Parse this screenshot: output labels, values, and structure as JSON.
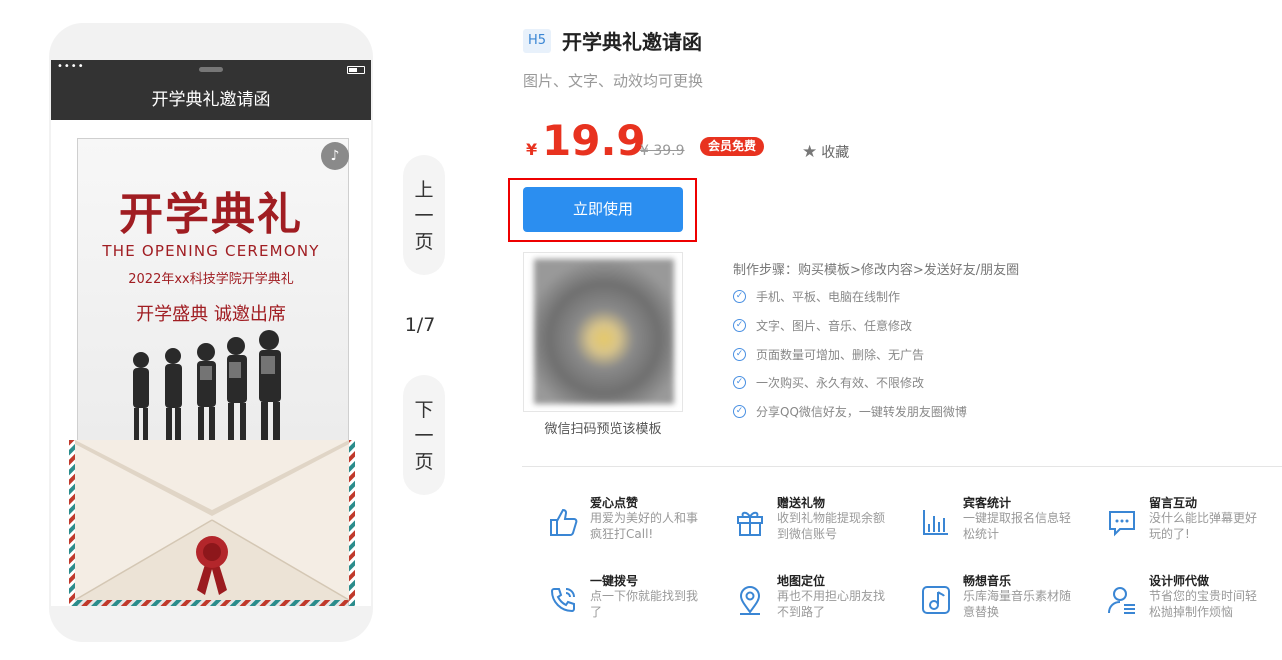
{
  "phone": {
    "status_dots": "••••",
    "title": "开学典礼邀请函",
    "card": {
      "title": "开学典礼",
      "english": "THE OPENING CEREMONY",
      "subtitle": "2022年xx科技学院开学典礼",
      "slogan": "开学盛典  诚邀出席"
    }
  },
  "pager": {
    "prev": [
      "上",
      "一",
      "页"
    ],
    "count": "1/7",
    "next": [
      "下",
      "一",
      "页"
    ]
  },
  "product": {
    "tag": "H5",
    "title": "开学典礼邀请函",
    "desc": "图片、文字、动效均可更换",
    "currency": "¥",
    "price": "19.9",
    "old_price": "¥ 39.9",
    "vip_badge": "会员免费",
    "favorite": "收藏",
    "use_button": "立即使用",
    "qr_caption": "微信扫码预览该模板",
    "steps": "制作步骤：购买模板>修改内容>发送好友/朋友圈",
    "features": [
      "手机、平板、电脑在线制作",
      "文字、图片、音乐、任意修改",
      "页面数量可增加、删除、无广告",
      "一次购买、永久有效、不限修改",
      "分享QQ微信好友，一键转发朋友圈微博"
    ]
  },
  "features_grid": [
    {
      "title": "爱心点赞",
      "desc": "用爱为美好的人和事疯狂打Call!",
      "icon": "thumbs-up-icon"
    },
    {
      "title": "赠送礼物",
      "desc": "收到礼物能提现余额到微信账号",
      "icon": "gift-icon"
    },
    {
      "title": "宾客统计",
      "desc": "一键提取报名信息轻松统计",
      "icon": "bar-chart-icon"
    },
    {
      "title": "留言互动",
      "desc": "没什么能比弹幕更好玩的了!",
      "icon": "message-icon"
    },
    {
      "title": "一键拨号",
      "desc": "点一下你就能找到我了",
      "icon": "phone-call-icon"
    },
    {
      "title": "地图定位",
      "desc": "再也不用担心朋友找不到路了",
      "icon": "location-pin-icon"
    },
    {
      "title": "畅想音乐",
      "desc": "乐库海量音乐素材随意替换",
      "icon": "music-icon"
    },
    {
      "title": "设计师代做",
      "desc": "节省您的宝贵时间轻松抛掉制作烦恼",
      "icon": "designer-icon"
    }
  ],
  "colors": {
    "accent": "#2b8ef0",
    "price": "#e8321f",
    "card_red": "#a01d22"
  }
}
